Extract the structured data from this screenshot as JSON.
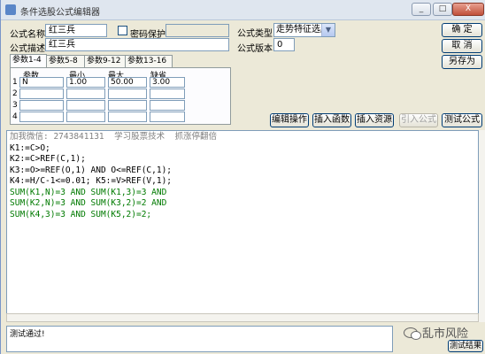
{
  "window": {
    "title": "条件选股公式编辑器",
    "min": "_",
    "max": "□",
    "close": "X"
  },
  "form": {
    "name_label": "公式名称",
    "name_value": "红三兵",
    "password_label": "密码保护",
    "desc_label": "公式描述",
    "desc_value": "红三兵",
    "type_label": "公式类型",
    "type_value": "走势特征选股",
    "version_label": "公式版本",
    "version_value": "0"
  },
  "buttons": {
    "ok": "确  定",
    "cancel": "取  消",
    "save_as": "另存为",
    "edit_op": "编辑操作",
    "insert_func": "插入函数",
    "insert_res": "插入资源",
    "import_formula": "引入公式",
    "test_formula": "测试公式",
    "test_result": "测试结果"
  },
  "tabs": [
    "参数1-4",
    "参数5-8",
    "参数9-12",
    "参数13-16"
  ],
  "params": {
    "headers": [
      "参数",
      "最小",
      "最大",
      "缺省"
    ],
    "rows": [
      {
        "num": "1",
        "name": "N",
        "min": "1.00",
        "max": "50.00",
        "default": "3.00"
      },
      {
        "num": "2",
        "name": "",
        "min": "",
        "max": "",
        "default": ""
      },
      {
        "num": "3",
        "name": "",
        "min": "",
        "max": "",
        "default": ""
      },
      {
        "num": "4",
        "name": "",
        "min": "",
        "max": "",
        "default": ""
      }
    ]
  },
  "code": {
    "comment": "加我微信: 2743841131  学习股票技术  抓涨停翻倍",
    "line1": "K1:=C>O;",
    "line2": "K2:=C>REF(C,1);",
    "line3": "K3:=O>=REF(O,1) AND O<=REF(C,1);",
    "line4": "K4:=H/C-1<=0.01; K5:=V>REF(V,1);",
    "line5": "SUM(K1,N)=3 AND SUM(K1,3)=3 AND",
    "line6": "SUM(K2,N)=3 AND SUM(K3,2)=2 AND",
    "line7": "SUM(K4,3)=3 AND SUM(K5,2)=2;"
  },
  "status": {
    "text": "测试通过!"
  },
  "watermark": {
    "text": "乱市风险"
  }
}
